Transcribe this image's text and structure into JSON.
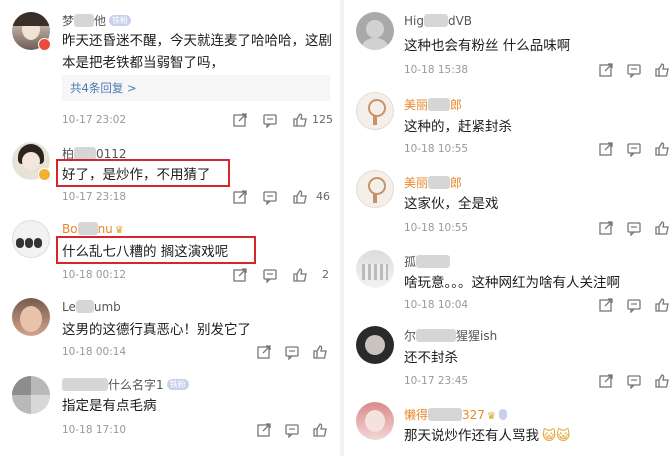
{
  "left": {
    "comments": [
      {
        "name": "梦",
        "name2": "他",
        "tag": "铁粉",
        "text": "昨天还昏迷不醒，今天就连麦了哈哈哈，这剧本是把老铁都当弱智了吗，",
        "replies": "共4条回复 >",
        "time": "10-17 23:02",
        "likes": "125"
      },
      {
        "name": "柏",
        "name2": "0112",
        "text": "好了，是炒作，不用猜了",
        "time": "10-17 23:18",
        "likes": "46"
      },
      {
        "name": "Bo",
        "name2": "nu",
        "text": "什么乱七八糟的 搁这演戏呢",
        "time": "10-18 00:12",
        "likes": "2"
      },
      {
        "name": "Le",
        "name2": "umb",
        "text": "这男的这德行真恶心！别发它了",
        "time": "10-18 00:14"
      },
      {
        "name": "",
        "name2": "什么名字1",
        "tag": "铁粉",
        "text": "指定是有点毛病",
        "time": "10-18 17:10"
      }
    ]
  },
  "right": {
    "comments": [
      {
        "name": "Hig",
        "name2": "dVB",
        "text": "这种也会有粉丝 什么品味啊",
        "time": "10-18 15:38"
      },
      {
        "name": "美丽",
        "name2": "郎",
        "text": "这种的，赶紧封杀",
        "time": "10-18 10:55"
      },
      {
        "name": "美丽",
        "name2": "郎",
        "text": "这家伙，全是戏",
        "time": "10-18 10:55"
      },
      {
        "name": "孤",
        "name2": "",
        "text": "啥玩意。。。这种网红为啥有人关注啊",
        "time": "10-18 10:04"
      },
      {
        "name": "尔",
        "name2": "猩猩ish",
        "text": "还不封杀",
        "time": "10-17 23:45"
      },
      {
        "name": "懒得",
        "name2": "327",
        "text": "那天说炒作还有人骂我",
        "time": ""
      }
    ]
  },
  "colors": {
    "accent": "#d6252c",
    "link": "#4a7ab5",
    "orange": "#e8872a"
  }
}
